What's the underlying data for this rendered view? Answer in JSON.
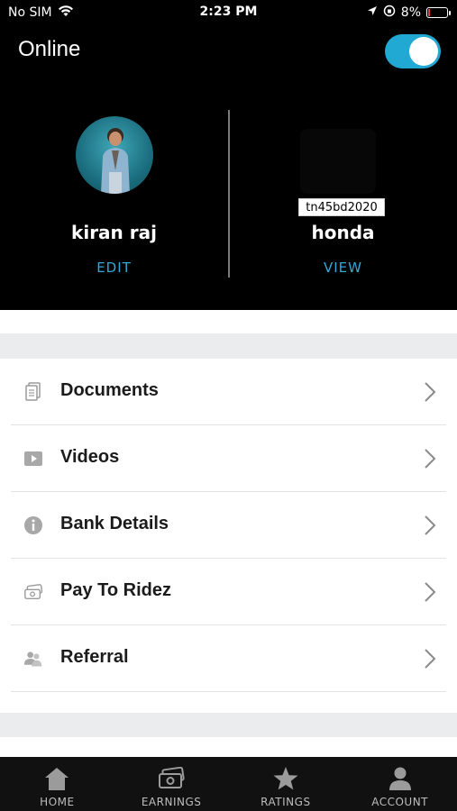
{
  "status_bar": {
    "carrier": "No SIM",
    "time": "2:23 PM",
    "battery_percent": "8%"
  },
  "header": {
    "status_label": "Online",
    "online_toggle_on": true,
    "profile": {
      "name": "kiran raj",
      "edit_label": "EDIT"
    },
    "vehicle": {
      "plate": "tn45bd2020",
      "name": "honda",
      "view_label": "VIEW"
    }
  },
  "menu": {
    "items": [
      {
        "label": "Documents",
        "icon": "document-icon"
      },
      {
        "label": "Videos",
        "icon": "video-icon"
      },
      {
        "label": "Bank Details",
        "icon": "info-icon"
      },
      {
        "label": "Pay To Ridez",
        "icon": "money-icon"
      },
      {
        "label": "Referral",
        "icon": "users-icon"
      }
    ]
  },
  "tabbar": {
    "tabs": [
      {
        "label": "HOME",
        "icon": "home-icon"
      },
      {
        "label": "EARNINGS",
        "icon": "cash-icon"
      },
      {
        "label": "RATINGS",
        "icon": "star-icon"
      },
      {
        "label": "ACCOUNT",
        "icon": "person-icon"
      }
    ]
  },
  "colors": {
    "accent": "#33a9d6",
    "toggle": "#21a9d4",
    "header_bg": "#000000",
    "tabbar_bg": "#111111"
  }
}
